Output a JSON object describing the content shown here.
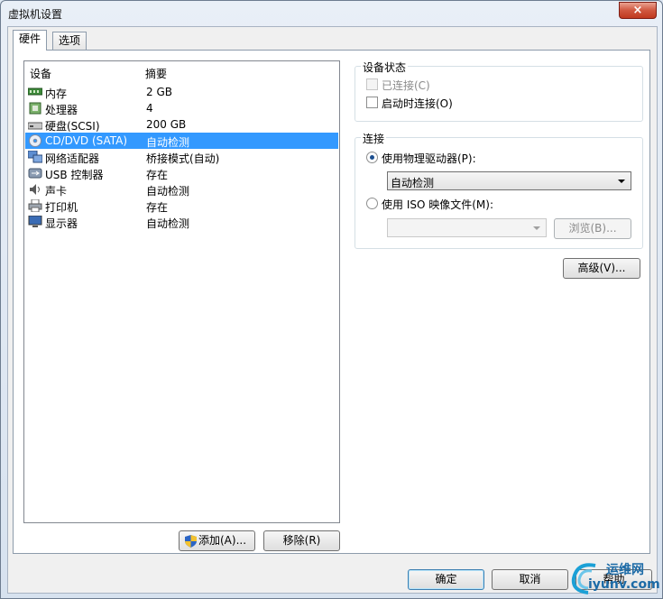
{
  "window": {
    "title": "虚拟机设置",
    "close_label": "×"
  },
  "tabs": [
    {
      "label": "硬件"
    },
    {
      "label": "选项"
    }
  ],
  "device_list": {
    "columns": [
      "设备",
      "摘要"
    ],
    "rows": [
      {
        "name": "内存",
        "summary": "2 GB",
        "icon": "memory-icon"
      },
      {
        "name": "处理器",
        "summary": "4",
        "icon": "processor-icon"
      },
      {
        "name": "硬盘(SCSI)",
        "summary": "200 GB",
        "icon": "harddisk-icon"
      },
      {
        "name": "CD/DVD (SATA)",
        "summary": "自动检测",
        "icon": "cd-dvd-icon",
        "selected": true
      },
      {
        "name": "网络适配器",
        "summary": "桥接模式(自动)",
        "icon": "network-adapter-icon"
      },
      {
        "name": "USB 控制器",
        "summary": "存在",
        "icon": "usb-icon"
      },
      {
        "name": "声卡",
        "summary": "自动检测",
        "icon": "sound-card-icon"
      },
      {
        "name": "打印机",
        "summary": "存在",
        "icon": "printer-icon"
      },
      {
        "name": "显示器",
        "summary": "自动检测",
        "icon": "monitor-icon"
      }
    ]
  },
  "list_buttons": {
    "add": "添加(A)...",
    "remove": "移除(R)"
  },
  "device_status": {
    "title": "设备状态",
    "connected": {
      "label": "已连接(C)",
      "checked": false,
      "disabled": true
    },
    "connect_at_power_on": {
      "label": "启动时连接(O)",
      "checked": false
    }
  },
  "connection": {
    "title": "连接",
    "physical_drive": {
      "label": "使用物理驱动器(P):",
      "selected": true,
      "value": "自动检测"
    },
    "iso_image": {
      "label": "使用 ISO 映像文件(M):",
      "selected": false,
      "value": "",
      "browse": "浏览(B)..."
    }
  },
  "advanced_button": "高级(V)...",
  "footer": {
    "ok": "确定",
    "cancel": "取消",
    "help": "帮助"
  },
  "watermark": {
    "line1": "运维网",
    "line2": "iyunv.com"
  },
  "colors": {
    "selection": "#3399ff",
    "title_bar": "#dfe8f3",
    "close": "#c0391f"
  }
}
